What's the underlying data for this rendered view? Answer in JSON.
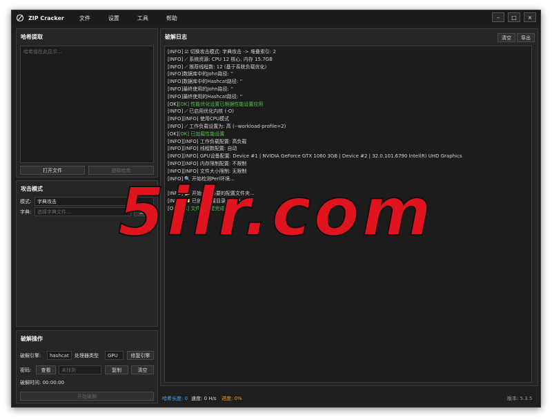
{
  "window": {
    "title": "ZIP Cracker",
    "menu": [
      "文件",
      "设置",
      "工具",
      "帮助"
    ],
    "controls": {
      "minimize": "–",
      "maximize": "□",
      "close": "×"
    }
  },
  "hash_panel": {
    "title": "哈希提取",
    "placeholder": "哈希值在此显示...",
    "open_file": "打开文件",
    "extract_hash": "提取哈希"
  },
  "attack_panel": {
    "title": "攻击模式",
    "mode_label": "模式:",
    "mode_value": "字典攻击",
    "dict_label": "字典:",
    "dict_placeholder": "选择字典文件...",
    "generate": "生成"
  },
  "crack_panel": {
    "title": "破解操作",
    "engine_label": "破解引擎:",
    "engine_value": "hashcat",
    "processor_label": "处理器类型",
    "processor_value": "GPU",
    "repair_engine": "修复引擎",
    "password_label": "密码:",
    "view": "查看",
    "password_value": "未找到",
    "copy": "复制",
    "clear": "清空",
    "time_label": "破解时间: 00:00:00",
    "start": "开始破解"
  },
  "log_panel": {
    "title": "破解日志",
    "clear": "清空",
    "export": "导出",
    "lines": [
      {
        "type": "info",
        "prefix": "[INFO]",
        "icon": "☑",
        "text": "切换攻击模式: 字典攻击 -> 堆叠索引: 2"
      },
      {
        "type": "info",
        "prefix": "[INFO]",
        "icon": "⟋",
        "text": "系统资源: CPU 12 核心, 内存 15.7GB"
      },
      {
        "type": "info",
        "prefix": "[INFO]",
        "icon": "⟋",
        "text": "推荐线程数: 12 (基于系统负载优化)"
      },
      {
        "type": "info",
        "prefix": "[INFO]",
        "icon": "",
        "text": "数据库中的John路径: ''"
      },
      {
        "type": "info",
        "prefix": "[INFO]",
        "icon": "",
        "text": "数据库中的Hashcat路径: ''"
      },
      {
        "type": "info",
        "prefix": "[INFO]",
        "icon": "",
        "text": "最终使用的John路径: ''"
      },
      {
        "type": "info",
        "prefix": "[INFO]",
        "icon": "",
        "text": "最终使用的Hashcat路径: ''"
      },
      {
        "type": "ok",
        "prefix": "[OK]",
        "icon": "",
        "text": "[OK] 性能优化设置已根据性能设置应用"
      },
      {
        "type": "info",
        "prefix": "[INFO]",
        "icon": "⟋",
        "text": "已启用优化内核 (-O)"
      },
      {
        "type": "info",
        "prefix": "[INFO]",
        "icon": "",
        "text": "[INFO] 使用CPU模式"
      },
      {
        "type": "info",
        "prefix": "[INFO]",
        "icon": "⟋",
        "text": "工作负载设置为: 高 (--workload-profile=2)"
      },
      {
        "type": "ok",
        "prefix": "[OK]",
        "icon": "",
        "text": "[OK] 已加载性能设置"
      },
      {
        "type": "info",
        "prefix": "[INFO]",
        "icon": "",
        "text": "[INFO] 工作负载配置: 高负载"
      },
      {
        "type": "info",
        "prefix": "[INFO]",
        "icon": "",
        "text": "[INFO] 线程数配置: 自动"
      },
      {
        "type": "info",
        "prefix": "[INFO]",
        "icon": "",
        "text": "[INFO] GPU设备配置: Device #1 | NVIDIA GeForce GTX 1060 3GB | Device #2 | 32.0.101.6790 Intel(R) UHD Graphics"
      },
      {
        "type": "info",
        "prefix": "[INFO]",
        "icon": "",
        "text": "[INFO] 内存限制配置: 不限制"
      },
      {
        "type": "info",
        "prefix": "[INFO]",
        "icon": "",
        "text": "[INFO] 文件大小限制: 无限制"
      },
      {
        "type": "info",
        "prefix": "[INFO]",
        "icon": "🔍",
        "text": "开始检测Perl环境..."
      },
      {
        "type": "blank",
        "prefix": "",
        "icon": "",
        "text": ""
      },
      {
        "type": "info",
        "prefix": "[INFO]",
        "icon": "📁",
        "text": "开始创建必要的配置文件夹..."
      },
      {
        "type": "info",
        "prefix": "[INFO]",
        "icon": "📁",
        "text": "已创建配置目录: config"
      },
      {
        "type": "ok",
        "prefix": "[OK]",
        "icon": "",
        "text": "[OK] 文件夹创建完成"
      }
    ]
  },
  "status": {
    "hash_length": "哈希长度: 0",
    "speed": "速度: 0 H/s",
    "progress": "进度: 0%",
    "version": "版本: 5.3.5"
  },
  "colors": {
    "background": "#1f1f1f",
    "panel": "#262626",
    "ok_green": "#4ec24e",
    "hash_blue": "#4aa3ff",
    "progress_orange": "#f0a020",
    "watermark_red": "#e0141e"
  },
  "watermark": {
    "text": "5ilr.com"
  }
}
